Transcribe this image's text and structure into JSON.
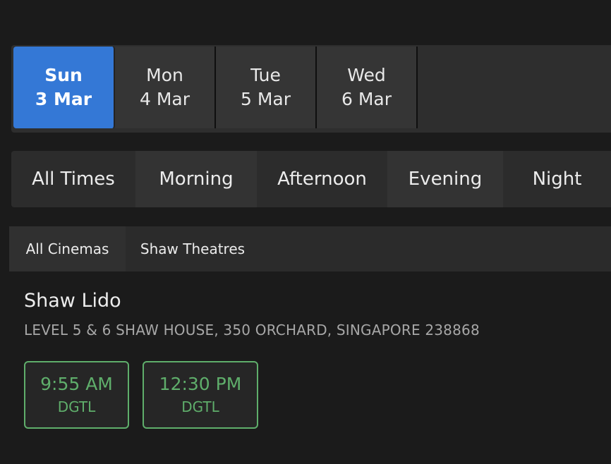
{
  "dates": [
    {
      "day": "Sun",
      "date": "3 Mar",
      "selected": true
    },
    {
      "day": "Mon",
      "date": "4 Mar",
      "selected": false
    },
    {
      "day": "Tue",
      "date": "5 Mar",
      "selected": false
    },
    {
      "day": "Wed",
      "date": "6 Mar",
      "selected": false
    }
  ],
  "time_filters": [
    "All Times",
    "Morning",
    "Afternoon",
    "Evening",
    "Night"
  ],
  "cinema_filters": [
    "All Cinemas",
    "Shaw Theatres"
  ],
  "cinema": {
    "name": "Shaw Lido",
    "address": "LEVEL 5 & 6 SHAW HOUSE, 350 ORCHARD, SINGAPORE 238868"
  },
  "showtimes": [
    {
      "time": "9:55 AM",
      "format": "DGTL"
    },
    {
      "time": "12:30 PM",
      "format": "DGTL"
    }
  ],
  "colors": {
    "background": "#1b1b1b",
    "selected_date": "#3478d6",
    "showtime_accent": "#5fae6b",
    "address_text": "#a7a7a7"
  }
}
